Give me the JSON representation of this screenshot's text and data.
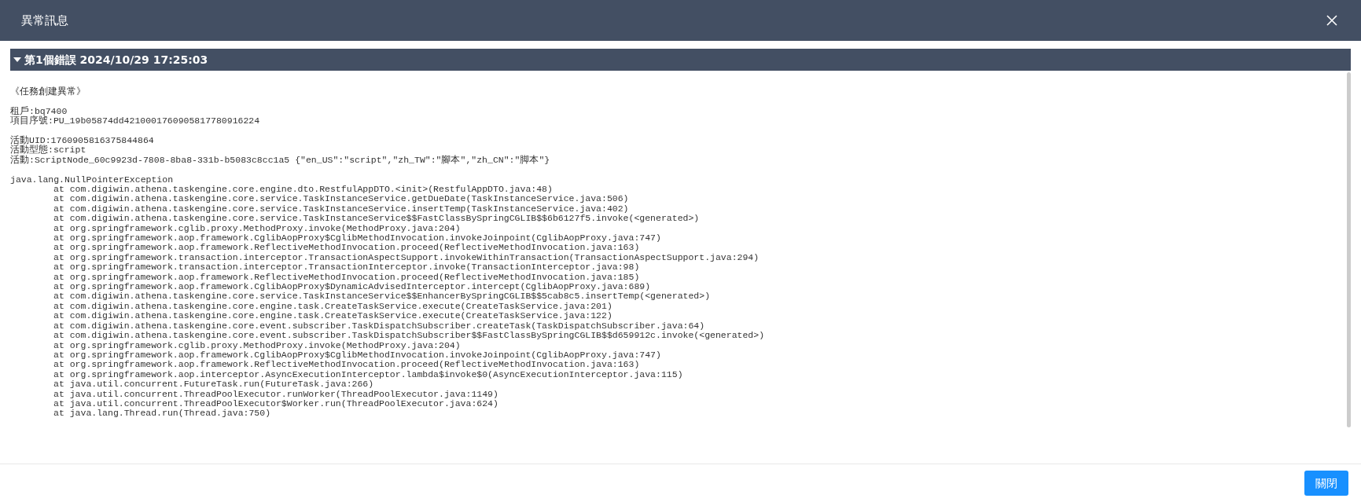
{
  "dialog": {
    "title": "異常訊息"
  },
  "error_section": {
    "title": "第1個錯誤 2024/10/29 17:25:03",
    "expanded": true,
    "message_blocks": [
      [
        "《任務創建異常》"
      ],
      [
        "租戶:bq7400",
        "項目序號:PU_19b05874dd4210001760905817780916224"
      ],
      [
        "活動UID:1760905816375844864",
        "活動型態:script",
        "活動:ScriptNode_60c9923d-7808-8ba8-331b-b5083c8cc1a5 {\"en_US\":\"script\",\"zh_TW\":\"腳本\",\"zh_CN\":\"脚本\"}"
      ]
    ],
    "exception": "java.lang.NullPointerException",
    "stack_frames": [
      "at com.digiwin.athena.taskengine.core.engine.dto.RestfulAppDTO.<init>(RestfulAppDTO.java:48)",
      "at com.digiwin.athena.taskengine.core.service.TaskInstanceService.getDueDate(TaskInstanceService.java:506)",
      "at com.digiwin.athena.taskengine.core.service.TaskInstanceService.insertTemp(TaskInstanceService.java:402)",
      "at com.digiwin.athena.taskengine.core.service.TaskInstanceService$$FastClassBySpringCGLIB$$6b6127f5.invoke(<generated>)",
      "at org.springframework.cglib.proxy.MethodProxy.invoke(MethodProxy.java:204)",
      "at org.springframework.aop.framework.CglibAopProxy$CglibMethodInvocation.invokeJoinpoint(CglibAopProxy.java:747)",
      "at org.springframework.aop.framework.ReflectiveMethodInvocation.proceed(ReflectiveMethodInvocation.java:163)",
      "at org.springframework.transaction.interceptor.TransactionAspectSupport.invokeWithinTransaction(TransactionAspectSupport.java:294)",
      "at org.springframework.transaction.interceptor.TransactionInterceptor.invoke(TransactionInterceptor.java:98)",
      "at org.springframework.aop.framework.ReflectiveMethodInvocation.proceed(ReflectiveMethodInvocation.java:185)",
      "at org.springframework.aop.framework.CglibAopProxy$DynamicAdvisedInterceptor.intercept(CglibAopProxy.java:689)",
      "at com.digiwin.athena.taskengine.core.service.TaskInstanceService$$EnhancerBySpringCGLIB$$5cab8c5.insertTemp(<generated>)",
      "at com.digiwin.athena.taskengine.core.engine.task.CreateTaskService.execute(CreateTaskService.java:201)",
      "at com.digiwin.athena.taskengine.core.engine.task.CreateTaskService.execute(CreateTaskService.java:122)",
      "at com.digiwin.athena.taskengine.core.event.subscriber.TaskDispatchSubscriber.createTask(TaskDispatchSubscriber.java:64)",
      "at com.digiwin.athena.taskengine.core.event.subscriber.TaskDispatchSubscriber$$FastClassBySpringCGLIB$$d659912c.invoke(<generated>)",
      "at org.springframework.cglib.proxy.MethodProxy.invoke(MethodProxy.java:204)",
      "at org.springframework.aop.framework.CglibAopProxy$CglibMethodInvocation.invokeJoinpoint(CglibAopProxy.java:747)",
      "at org.springframework.aop.framework.ReflectiveMethodInvocation.proceed(ReflectiveMethodInvocation.java:163)",
      "at org.springframework.aop.interceptor.AsyncExecutionInterceptor.lambda$invoke$0(AsyncExecutionInterceptor.java:115)",
      "at java.util.concurrent.FutureTask.run(FutureTask.java:266)",
      "at java.util.concurrent.ThreadPoolExecutor.runWorker(ThreadPoolExecutor.java:1149)",
      "at java.util.concurrent.ThreadPoolExecutor$Worker.run(ThreadPoolExecutor.java:624)",
      "at java.lang.Thread.run(Thread.java:750)"
    ]
  },
  "footer": {
    "buttons": [
      "關閉"
    ]
  }
}
